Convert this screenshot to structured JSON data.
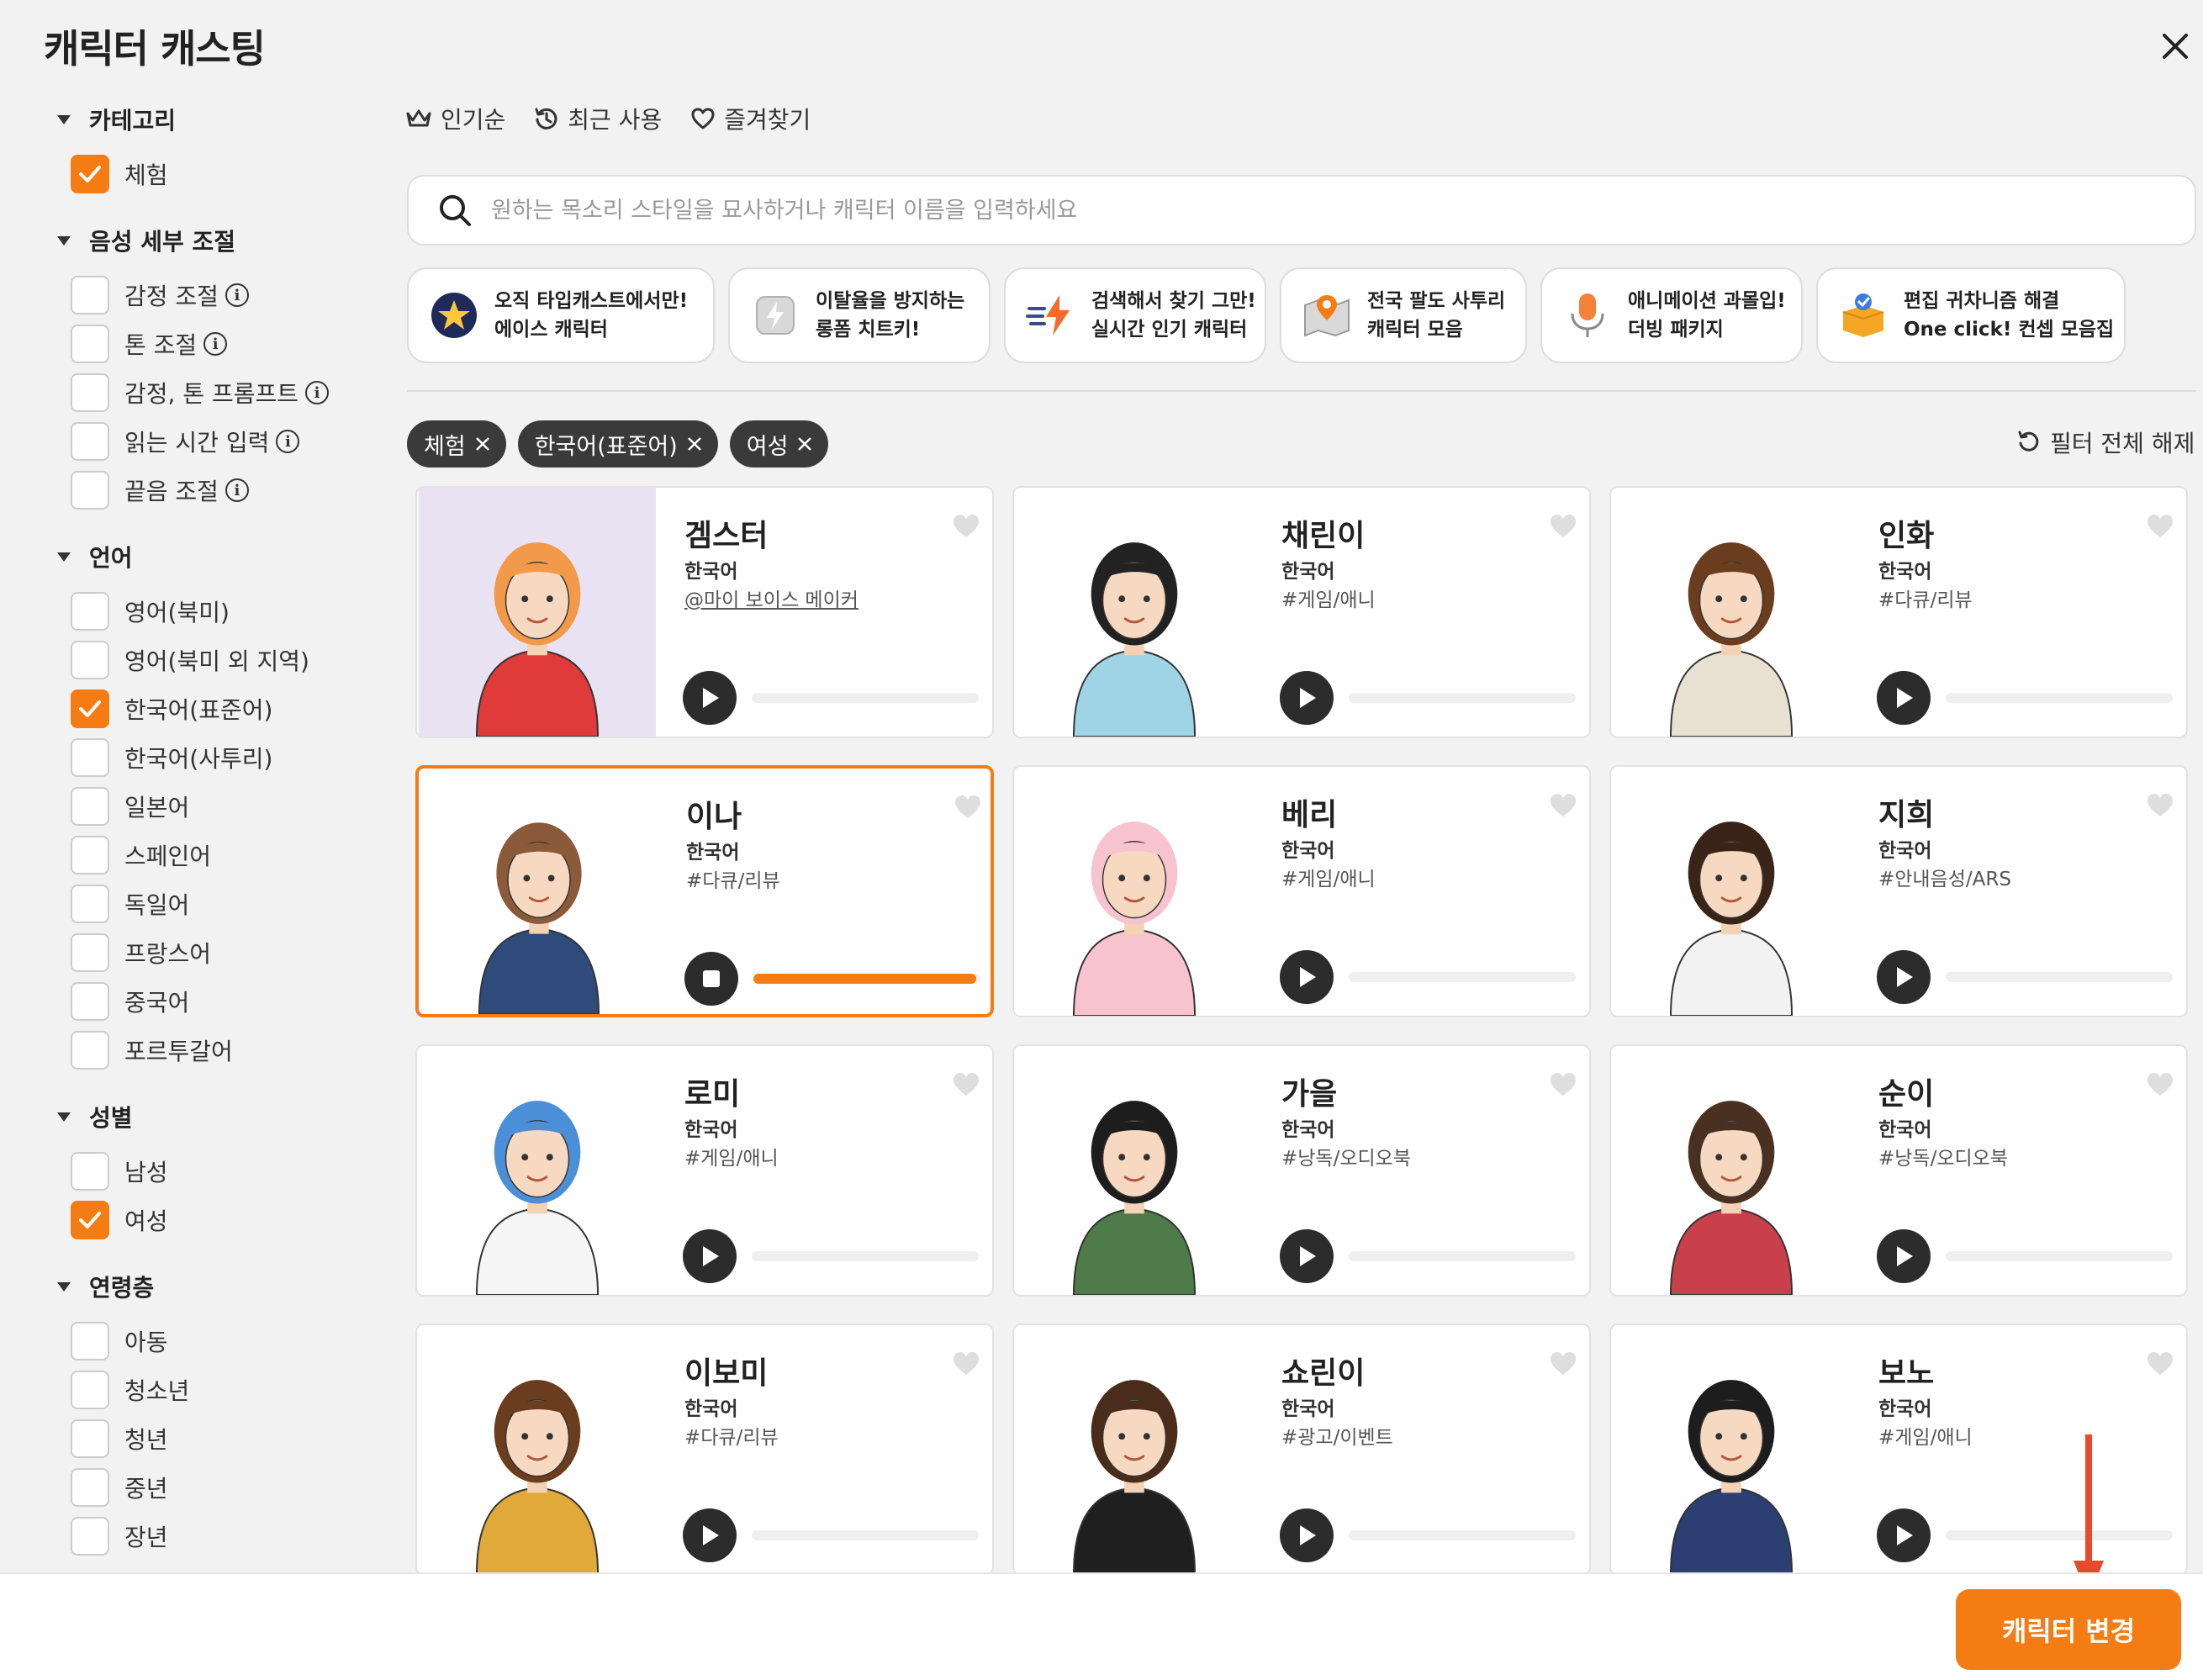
{
  "title": "캐릭터 캐스팅",
  "sidebar": {
    "sections": [
      {
        "label": "카테고리",
        "options": [
          {
            "label": "체험",
            "checked": true,
            "info": false
          }
        ]
      },
      {
        "label": "음성 세부 조절",
        "options": [
          {
            "label": "감정 조절",
            "checked": false,
            "info": true
          },
          {
            "label": "톤 조절",
            "checked": false,
            "info": true
          },
          {
            "label": "감정, 톤 프롬프트",
            "checked": false,
            "info": true
          },
          {
            "label": "읽는 시간 입력",
            "checked": false,
            "info": true
          },
          {
            "label": "끝음 조절",
            "checked": false,
            "info": true
          }
        ]
      },
      {
        "label": "언어",
        "options": [
          {
            "label": "영어(북미)",
            "checked": false
          },
          {
            "label": "영어(북미 외 지역)",
            "checked": false
          },
          {
            "label": "한국어(표준어)",
            "checked": true
          },
          {
            "label": "한국어(사투리)",
            "checked": false
          },
          {
            "label": "일본어",
            "checked": false
          },
          {
            "label": "스페인어",
            "checked": false
          },
          {
            "label": "독일어",
            "checked": false
          },
          {
            "label": "프랑스어",
            "checked": false
          },
          {
            "label": "중국어",
            "checked": false
          },
          {
            "label": "포르투갈어",
            "checked": false
          }
        ]
      },
      {
        "label": "성별",
        "options": [
          {
            "label": "남성",
            "checked": false
          },
          {
            "label": "여성",
            "checked": true
          }
        ]
      },
      {
        "label": "연령층",
        "options": [
          {
            "label": "아동",
            "checked": false
          },
          {
            "label": "청소년",
            "checked": false
          },
          {
            "label": "청년",
            "checked": false
          },
          {
            "label": "중년",
            "checked": false
          },
          {
            "label": "장년",
            "checked": false
          }
        ]
      }
    ]
  },
  "sort": {
    "popular": "인기순",
    "recent": "최근 사용",
    "favorites": "즐겨찾기"
  },
  "search": {
    "placeholder": "원하는 목소리 스타일을 묘사하거나 캐릭터 이름을 입력하세요",
    "value": ""
  },
  "promos": [
    {
      "line1": "오직 타입캐스트에서만!",
      "line2": "에이스 캐릭터",
      "icon": "star-badge-icon"
    },
    {
      "line1": "이탈율을 방지하는",
      "line2": "롱폼 치트키!",
      "icon": "lightning-icon"
    },
    {
      "line1": "검색해서 찾기 그만!",
      "line2": "실시간 인기 캐릭터",
      "icon": "fast-bolt-icon"
    },
    {
      "line1": "전국 팔도 사투리",
      "line2": "캐릭터 모음",
      "icon": "map-pin-icon"
    },
    {
      "line1": "애니메이션 과몰입!",
      "line2": "더빙 패키지",
      "icon": "microphone-icon"
    },
    {
      "line1": "편집 귀차니즘 해결",
      "line2": "One click! 컨셉 모음집",
      "icon": "package-icon"
    }
  ],
  "chips": [
    "체험",
    "한국어(표준어)",
    "여성"
  ],
  "reset_label": "필터 전체 해제",
  "characters": [
    {
      "name": "겜스터",
      "lang": "한국어",
      "tag": "@마이 보이스 메이커",
      "tag_link": true,
      "playing": false,
      "progress": 0,
      "bg": "#e9e2f3",
      "hair": "#f2994a",
      "cloth": "#e03a3a"
    },
    {
      "name": "채린이",
      "lang": "한국어",
      "tag": "#게임/애니",
      "tag_link": false,
      "playing": false,
      "progress": 0,
      "bg": "#ffffff",
      "hair": "#222222",
      "cloth": "#9fd3e6"
    },
    {
      "name": "인화",
      "lang": "한국어",
      "tag": "#다큐/리뷰",
      "tag_link": false,
      "playing": false,
      "progress": 0,
      "bg": "#ffffff",
      "hair": "#6b3d1f",
      "cloth": "#e8e1d2"
    },
    {
      "name": "이나",
      "lang": "한국어",
      "tag": "#다큐/리뷰",
      "tag_link": false,
      "playing": true,
      "progress": 0.98,
      "bg": "#ffffff",
      "hair": "#8a5a3a",
      "cloth": "#2f4b7c"
    },
    {
      "name": "베리",
      "lang": "한국어",
      "tag": "#게임/애니",
      "tag_link": false,
      "playing": false,
      "progress": 0,
      "bg": "#ffffff",
      "hair": "#f7c3cf",
      "cloth": "#f7c3cf"
    },
    {
      "name": "지희",
      "lang": "한국어",
      "tag": "#안내음성/ARS",
      "tag_link": false,
      "playing": false,
      "progress": 0,
      "bg": "#ffffff",
      "hair": "#3a2418",
      "cloth": "#f2f2f2"
    },
    {
      "name": "로미",
      "lang": "한국어",
      "tag": "#게임/애니",
      "tag_link": false,
      "playing": false,
      "progress": 0,
      "bg": "#ffffff",
      "hair": "#4b8fd8",
      "cloth": "#f5f5f5"
    },
    {
      "name": "가을",
      "lang": "한국어",
      "tag": "#낭독/오디오북",
      "tag_link": false,
      "playing": false,
      "progress": 0,
      "bg": "#ffffff",
      "hair": "#1d1d1d",
      "cloth": "#4f7a4a"
    },
    {
      "name": "순이",
      "lang": "한국어",
      "tag": "#낭독/오디오북",
      "tag_link": false,
      "playing": false,
      "progress": 0,
      "bg": "#ffffff",
      "hair": "#4a3020",
      "cloth": "#c9404a"
    },
    {
      "name": "이보미",
      "lang": "한국어",
      "tag": "#다큐/리뷰",
      "tag_link": false,
      "playing": false,
      "progress": 0,
      "bg": "#ffffff",
      "hair": "#6b3d1f",
      "cloth": "#e0a93a"
    },
    {
      "name": "쇼린이",
      "lang": "한국어",
      "tag": "#광고/이벤트",
      "tag_link": false,
      "playing": false,
      "progress": 0,
      "bg": "#ffffff",
      "hair": "#4a2c1a",
      "cloth": "#1f1f1f"
    },
    {
      "name": "보노",
      "lang": "한국어",
      "tag": "#게임/애니",
      "tag_link": false,
      "playing": false,
      "progress": 0,
      "bg": "#ffffff",
      "hair": "#1d1d1d",
      "cloth": "#2c3f73"
    }
  ],
  "footer": {
    "change_label": "캐릭터 변경"
  },
  "colors": {
    "accent": "#f57c12",
    "chip": "#3a3a3a",
    "arrow": "#e84a2e"
  }
}
